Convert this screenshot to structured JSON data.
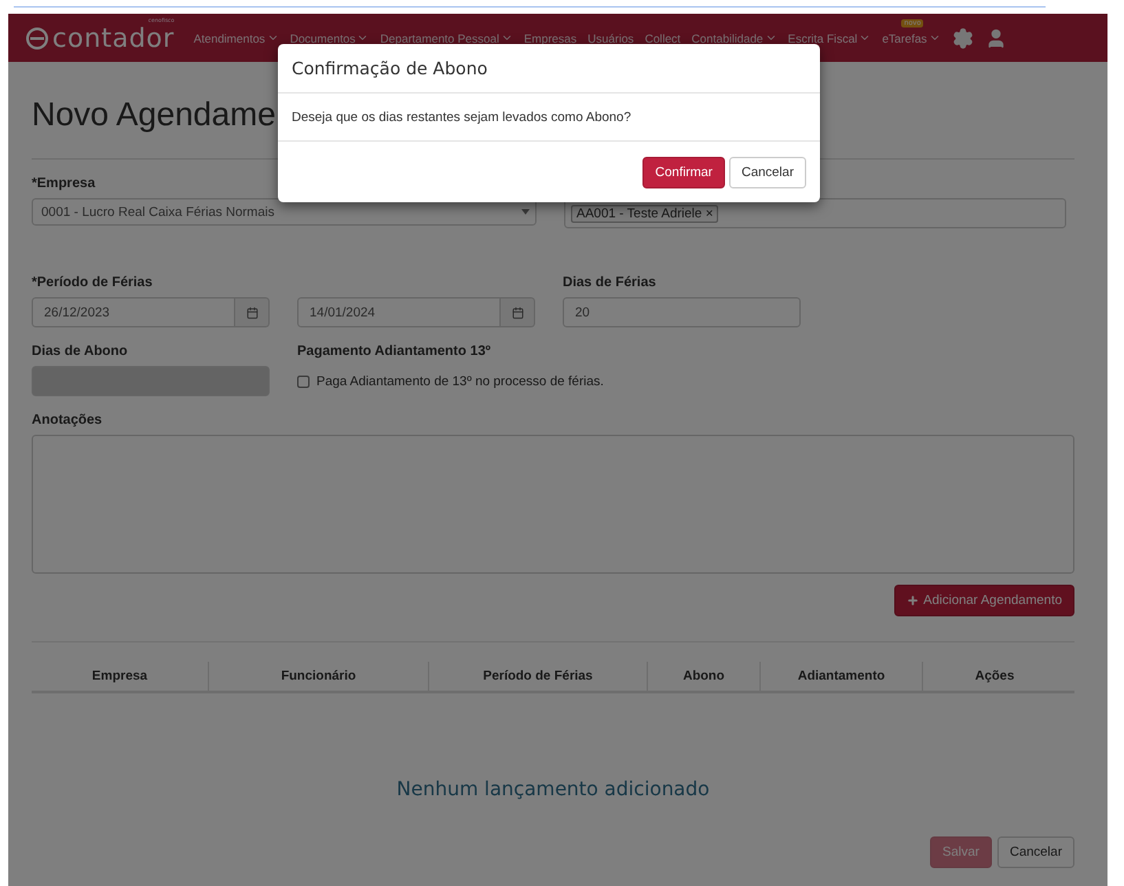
{
  "nav": {
    "logo": "contador",
    "logo_small": "cenofisco",
    "items": [
      {
        "label": "Atendimentos",
        "dropdown": true
      },
      {
        "label": "Documentos",
        "dropdown": true
      },
      {
        "label": "Departamento Pessoal",
        "dropdown": true
      },
      {
        "label": "Empresas",
        "dropdown": false
      },
      {
        "label": "Usuários",
        "dropdown": false
      },
      {
        "label": "Collect",
        "dropdown": false
      },
      {
        "label": "Contabilidade",
        "dropdown": true
      },
      {
        "label": "Escrita Fiscal",
        "dropdown": true
      },
      {
        "label": "eTarefas",
        "dropdown": true,
        "badge": "novo"
      }
    ]
  },
  "page": {
    "title": "Novo Agendame",
    "empresa": {
      "label": "*Empresa",
      "value": "0001 - Lucro Real Caixa Férias Normais"
    },
    "funcionario": {
      "tag": "AA001 - Teste Adriele",
      "remove": "×"
    },
    "periodo": {
      "label": "*Período de Férias",
      "start": "26/12/2023",
      "end": "14/01/2024"
    },
    "dias_ferias": {
      "label": "Dias de Férias",
      "value": "20"
    },
    "dias_abono": {
      "label": "Dias de Abono",
      "disabled": true
    },
    "adiantamento": {
      "label": "Pagamento Adiantamento 13º",
      "option": "Paga Adiantamento de 13º no processo de férias.",
      "checked": false
    },
    "anotacoes": {
      "label": "Anotações"
    },
    "add_button": "Adicionar Agendamento",
    "table": {
      "columns": [
        "Empresa",
        "Funcionário",
        "Período de Férias",
        "Abono",
        "Adiantamento",
        "Ações"
      ],
      "empty": "Nenhum lançamento adicionado"
    },
    "buttons": [
      {
        "label": "Salvar",
        "kind": "primary",
        "disabled": true
      },
      {
        "label": "Cancelar",
        "kind": "default",
        "disabled": false
      }
    ]
  },
  "modal": {
    "title": "Confirmação de Abono",
    "message": "Deseja que os dias restantes sejam levados como Abono?",
    "buttons": [
      {
        "label": "Confirmar",
        "kind": "primary",
        "disabled": false
      },
      {
        "label": "Cancelar",
        "kind": "default",
        "disabled": false
      }
    ]
  }
}
